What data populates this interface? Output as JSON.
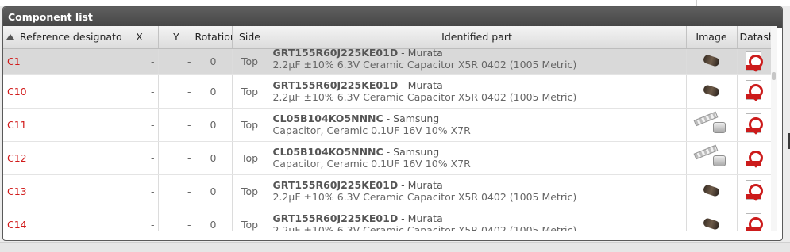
{
  "panel": {
    "title": "Component list"
  },
  "columns": {
    "ref": "Reference designator",
    "x": "X",
    "y": "Y",
    "rotation": "Rotation",
    "side": "Side",
    "part": "Identified part",
    "image": "Image",
    "datasheet": "Datasheet"
  },
  "rows": [
    {
      "ref": "C1",
      "x": "-",
      "y": "-",
      "rotation": "0",
      "side": "Top",
      "pn": "GRT155R60J225KE01D",
      "mfr": " - Murata",
      "desc": "2.2µF ±10% 6.3V Ceramic Capacitor X5R 0402 (1005 Metric)",
      "image": "capacitor-icon",
      "selected": true
    },
    {
      "ref": "C10",
      "x": "-",
      "y": "-",
      "rotation": "0",
      "side": "Top",
      "pn": "GRT155R60J225KE01D",
      "mfr": " - Murata",
      "desc": "2.2µF ±10% 6.3V Ceramic Capacitor X5R 0402 (1005 Metric)",
      "image": "capacitor-icon"
    },
    {
      "ref": "C11",
      "x": "-",
      "y": "-",
      "rotation": "0",
      "side": "Top",
      "pn": "CL05B104KO5NNNC",
      "mfr": " - Samsung",
      "desc": "Capacitor, Ceramic 0.1UF 16V 10% X7R",
      "image": "mlcc-tape-icon"
    },
    {
      "ref": "C12",
      "x": "-",
      "y": "-",
      "rotation": "0",
      "side": "Top",
      "pn": "CL05B104KO5NNNC",
      "mfr": " - Samsung",
      "desc": "Capacitor, Ceramic 0.1UF 16V 10% X7R",
      "image": "mlcc-tape-icon"
    },
    {
      "ref": "C13",
      "x": "-",
      "y": "-",
      "rotation": "0",
      "side": "Top",
      "pn": "GRT155R60J225KE01D",
      "mfr": " - Murata",
      "desc": "2.2µF ±10% 6.3V Ceramic Capacitor X5R 0402 (1005 Metric)",
      "image": "capacitor-icon"
    },
    {
      "ref": "C14",
      "x": "-",
      "y": "-",
      "rotation": "0",
      "side": "Top",
      "pn": "GRT155R60J225KE01D",
      "mfr": " - Murata",
      "desc": "2.2µF ±10% 6.3V Ceramic Capacitor X5R 0402 (1005 Metric)",
      "image": "capacitor-icon"
    }
  ],
  "colors": {
    "refText": "#d11a1a",
    "pdfRed": "#cc1b1b",
    "headerDark": "#4a4a4a",
    "selectedRow": "#d9d9d9"
  }
}
